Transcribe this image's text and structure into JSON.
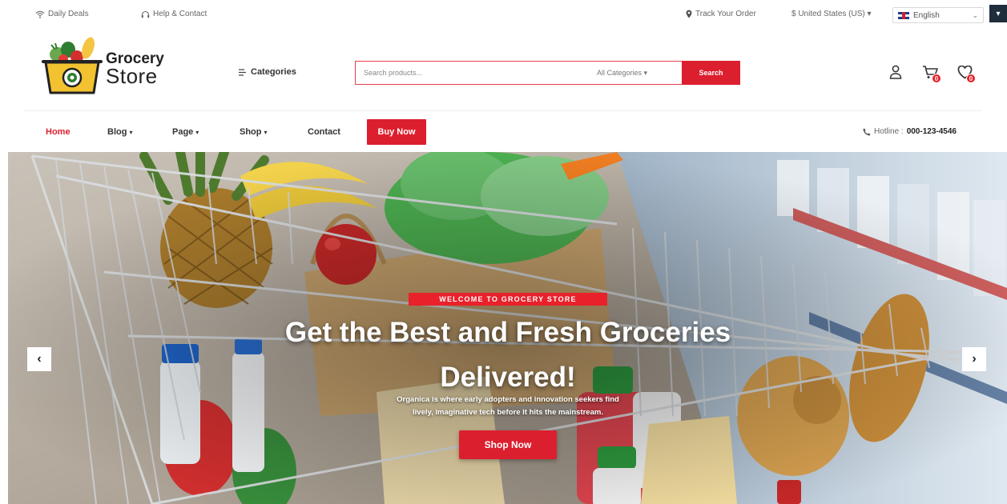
{
  "topbar": {
    "daily_deals": "Daily Deals",
    "help_contact": "Help & Contact",
    "track_order": "Track Your Order",
    "currency": "$ United States (US) ▾",
    "language": "English"
  },
  "header": {
    "logo_line1": "Grocery",
    "logo_line2": "Store",
    "categories_label": "Categories",
    "search_placeholder": "Search products...",
    "search_category": "All Categories ▾",
    "search_button": "Search",
    "cart_count": "0",
    "wishlist_count": "0"
  },
  "nav": {
    "items": [
      {
        "label": "Home"
      },
      {
        "label": "Blog"
      },
      {
        "label": "Page"
      },
      {
        "label": "Shop"
      },
      {
        "label": "Contact"
      }
    ],
    "buy_now": "Buy Now",
    "hotline_label": "Hotline :",
    "hotline_number": "000-123-4546"
  },
  "hero": {
    "tag": "WELCOME TO GROCERY STORE",
    "title_line1": "Get the Best and Fresh Groceries",
    "title_line2": "Delivered!",
    "desc_line1": "Organica is where early adopters and innovation seekers find",
    "desc_line2": "lively, imaginative tech before it hits the mainstream.",
    "cta": "Shop Now",
    "prev": "‹",
    "next": "›"
  },
  "colors": {
    "accent": "#dc1f2e",
    "dark": "#1f2d3d"
  }
}
